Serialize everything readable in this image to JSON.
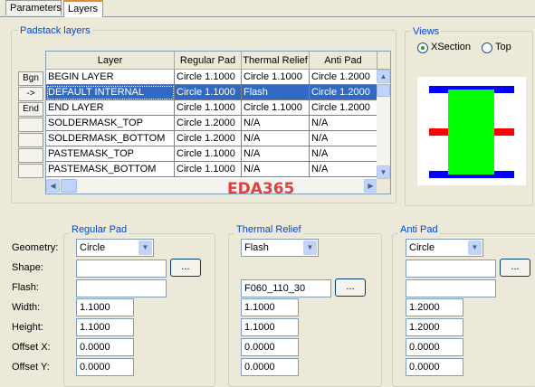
{
  "tabs": [
    {
      "label": "Parameters",
      "active": false
    },
    {
      "label": "Layers",
      "active": true
    }
  ],
  "padstack_layers": {
    "title": "Padstack layers",
    "columns": [
      "Layer",
      "Regular Pad",
      "Thermal Relief",
      "Anti Pad"
    ],
    "side_buttons": [
      "Bgn",
      "->",
      "End",
      "",
      "",
      "",
      ""
    ],
    "rows": [
      {
        "layer": "BEGIN LAYER",
        "regular": "Circle 1.1000",
        "thermal": "Circle 1.1000",
        "anti": "Circle 1.2000",
        "selected": false
      },
      {
        "layer": "DEFAULT INTERNAL",
        "regular": "Circle 1.1000",
        "thermal": "Flash",
        "anti": "Circle 1.2000",
        "selected": true
      },
      {
        "layer": "END LAYER",
        "regular": "Circle 1.1000",
        "thermal": "Circle 1.1000",
        "anti": "Circle 1.2000",
        "selected": false
      },
      {
        "layer": "SOLDERMASK_TOP",
        "regular": "Circle 1.2000",
        "thermal": "N/A",
        "anti": "N/A",
        "selected": false
      },
      {
        "layer": "SOLDERMASK_BOTTOM",
        "regular": "Circle 1.2000",
        "thermal": "N/A",
        "anti": "N/A",
        "selected": false
      },
      {
        "layer": "PASTEMASK_TOP",
        "regular": "Circle 1.1000",
        "thermal": "N/A",
        "anti": "N/A",
        "selected": false
      },
      {
        "layer": "PASTEMASK_BOTTOM",
        "regular": "Circle 1.1000",
        "thermal": "N/A",
        "anti": "N/A",
        "selected": false
      }
    ]
  },
  "views": {
    "title": "Views",
    "options": [
      {
        "label": "XSection",
        "selected": true
      },
      {
        "label": "Top",
        "selected": false
      }
    ],
    "colors": {
      "pad": "#0000ff",
      "thermal": "#ff0000",
      "drill": "#00ff00"
    }
  },
  "watermark": "EDA365",
  "labels": {
    "geometry": "Geometry:",
    "shape": "Shape:",
    "flash": "Flash:",
    "width": "Width:",
    "height": "Height:",
    "offset_x": "Offset X:",
    "offset_y": "Offset Y:"
  },
  "browse_label": "...",
  "regular_pad": {
    "title": "Regular Pad",
    "geometry": "Circle",
    "shape": "",
    "flash": "",
    "width": "1.1000",
    "height": "1.1000",
    "offset_x": "0.0000",
    "offset_y": "0.0000"
  },
  "thermal_relief": {
    "title": "Thermal Relief",
    "geometry": "Flash",
    "flash": "F060_110_30",
    "width": "1.1000",
    "height": "1.1000",
    "offset_x": "0.0000",
    "offset_y": "0.0000"
  },
  "anti_pad": {
    "title": "Anti Pad",
    "geometry": "Circle",
    "shape": "",
    "flash": "",
    "width": "1.2000",
    "height": "1.2000",
    "offset_x": "0.0000",
    "offset_y": "0.0000"
  }
}
